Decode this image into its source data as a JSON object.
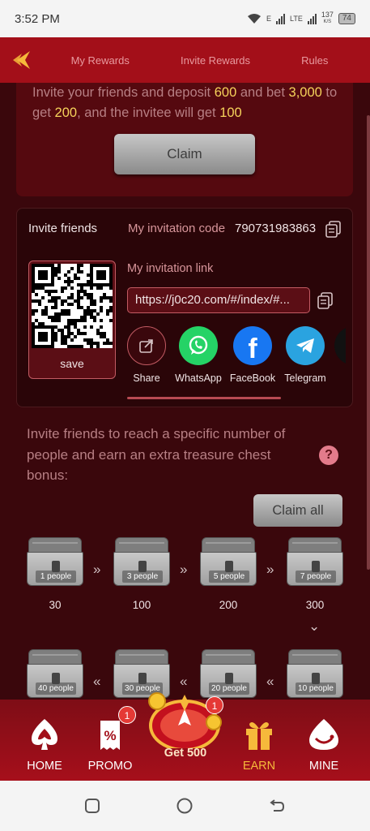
{
  "status_bar": {
    "time": "3:52 PM",
    "network_e": "E",
    "network_lte": "LTE",
    "speed_value": "137",
    "speed_unit": "K/S",
    "battery": "74"
  },
  "header": {
    "tabs": [
      "My Rewards",
      "Invite Rewards",
      "Rules"
    ]
  },
  "promo": {
    "parts": [
      "Invite your friends and deposit",
      "600",
      "and bet",
      "3,000",
      "to get",
      "200",
      ", and the invitee will get",
      "100"
    ],
    "claim_label": "Claim"
  },
  "invite": {
    "title": "Invite friends",
    "code_label": "My invitation code",
    "code_value": "790731983863",
    "save_label": "save",
    "link_label": "My invitation link",
    "link_value": "https://j0c20.com/#/index/#...",
    "share_options": [
      {
        "label": "Share",
        "icon": "share-icon"
      },
      {
        "label": "WhatsApp",
        "icon": "whatsapp-icon"
      },
      {
        "label": "FaceBook",
        "icon": "facebook-icon"
      },
      {
        "label": "Telegram",
        "icon": "telegram-icon"
      }
    ],
    "colors": {
      "whatsapp": "#25d366",
      "facebook": "#1877f2",
      "telegram": "#2aa3e0"
    }
  },
  "treasure": {
    "description": "Invite friends to reach a specific number of people and earn an extra treasure chest bonus:",
    "claim_all_label": "Claim all",
    "chests_row1": [
      {
        "people": "1 people",
        "reward": "30"
      },
      {
        "people": "3 people",
        "reward": "100"
      },
      {
        "people": "5 people",
        "reward": "200"
      },
      {
        "people": "7 people",
        "reward": "300"
      }
    ],
    "chests_row2": [
      {
        "people": "40 people"
      },
      {
        "people": "30 people"
      },
      {
        "people": "20 people"
      },
      {
        "people": "10 people"
      }
    ]
  },
  "bottom_nav": {
    "items": [
      {
        "label": "HOME",
        "icon": "spade-icon"
      },
      {
        "label": "PROMO",
        "icon": "coupon-icon",
        "badge": "1"
      },
      {
        "label": "Get 500",
        "icon": "lucky-wheel-icon",
        "badge": "1"
      },
      {
        "label": "EARN",
        "icon": "gift-icon",
        "active": true
      },
      {
        "label": "MINE",
        "icon": "profile-icon"
      }
    ],
    "active_color": "#f6b93b"
  }
}
